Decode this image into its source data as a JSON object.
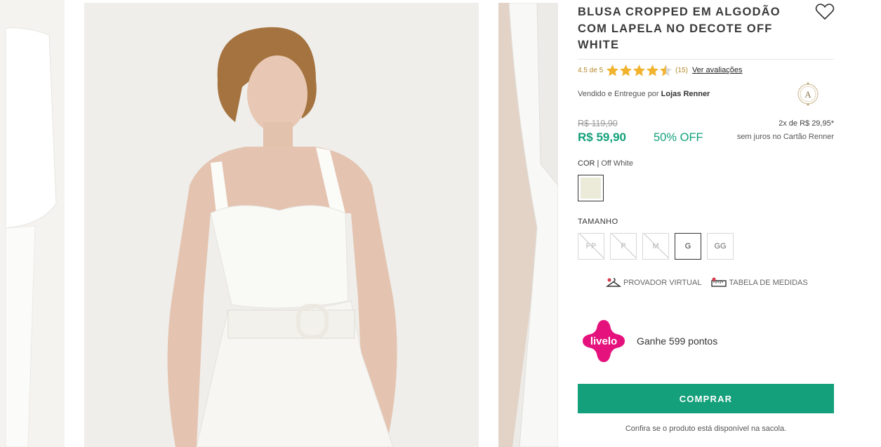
{
  "product": {
    "title": "BLUSA CROPPED EM ALGODÃO COM LAPELA NO DECOTE OFF WHITE",
    "rating_text": "4.5 de 5",
    "rating_value": 4.5,
    "review_count": "(15)",
    "review_link": "Ver avaliações",
    "seller_prefix": "Vendido e Entregue por",
    "seller_name": "Lojas Renner",
    "old_price": "R$ 119,90",
    "price": "R$ 59,90",
    "discount": "50% OFF",
    "installments": "2x de R$ 29,95*",
    "installments_note": "sem juros no Cartão Renner"
  },
  "color": {
    "label": "COR",
    "separator": "|",
    "value": "Off White",
    "swatch_hex": "#ecead9"
  },
  "size": {
    "label": "TAMANHO",
    "options": [
      {
        "label": "PP",
        "available": false
      },
      {
        "label": "P",
        "available": false
      },
      {
        "label": "M",
        "available": false
      },
      {
        "label": "G",
        "available": true,
        "selected": true
      },
      {
        "label": "GG",
        "available": true
      }
    ]
  },
  "tools": {
    "virtual_fitting": "PROVADOR VIRTUAL",
    "size_chart": "TABELA DE MEDIDAS"
  },
  "livelo": {
    "logo_text": "livelo",
    "points": "Ganhe 599 pontos",
    "brand_color": "#e5127d"
  },
  "buy": {
    "label": "COMPRAR",
    "color": "#14a07a",
    "availability": "Confira se o produto está disponível na sacola."
  },
  "seller_logo_letter": "A",
  "accent_colors": {
    "price": "#12a07a",
    "rating": "#f1b22c"
  }
}
